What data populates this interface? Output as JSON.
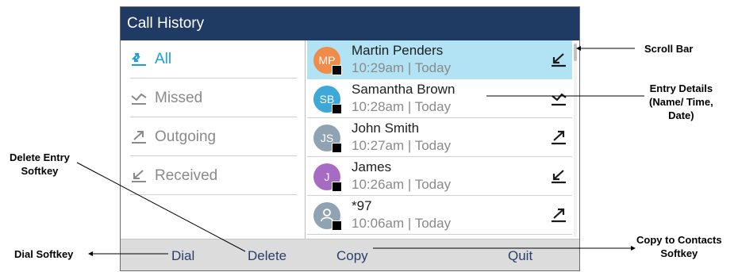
{
  "screen": {
    "title": "Call History",
    "colors": {
      "titlebar": "#1f3a63",
      "accent": "#1aa0d8",
      "selected_row": "#b2e3f5",
      "softkey_bar": "#dcdcdc"
    },
    "filters": [
      {
        "label": "All",
        "icon": "all-calls-icon",
        "active": true
      },
      {
        "label": "Missed",
        "icon": "missed-call-icon",
        "active": false
      },
      {
        "label": "Outgoing",
        "icon": "outgoing-call-icon",
        "active": false
      },
      {
        "label": "Received",
        "icon": "received-call-icon",
        "active": false
      }
    ],
    "entries": [
      {
        "name": "Martin Penders",
        "initials": "MP",
        "time": "10:29am | Today",
        "avatar_color": "#f08c4a",
        "call_icon": "received-call-icon",
        "selected": true
      },
      {
        "name": "Samantha Brown",
        "initials": "SB",
        "time": "10:28am | Today",
        "avatar_color": "#3ea8d8",
        "call_icon": "missed-call-icon",
        "selected": false
      },
      {
        "name": "John Smith",
        "initials": "JS",
        "time": "10:27am | Today",
        "avatar_color": "#8fa3b3",
        "call_icon": "outgoing-call-icon",
        "selected": false
      },
      {
        "name": "James",
        "initials": "J",
        "time": "10:26am | Today",
        "avatar_color": "#a66cc4",
        "call_icon": "received-call-icon",
        "selected": false
      },
      {
        "name": "*97",
        "initials": "",
        "time": "10:06am | Today",
        "avatar_color": "#8fa3b3",
        "avatar_icon": "person-icon",
        "call_icon": "outgoing-call-icon",
        "selected": false
      }
    ],
    "softkeys": [
      "Dial",
      "Delete",
      "Copy",
      "Quit"
    ]
  },
  "callouts": {
    "scroll_bar": "Scroll Bar",
    "entry_details": [
      "Entry Details",
      "(Name/ Time,",
      "Date)"
    ],
    "delete_entry": [
      "Delete Entry",
      "Softkey"
    ],
    "dial_softkey": "Dial Softkey",
    "copy_to_contacts": [
      "Copy to Contacts",
      "Softkey"
    ]
  }
}
